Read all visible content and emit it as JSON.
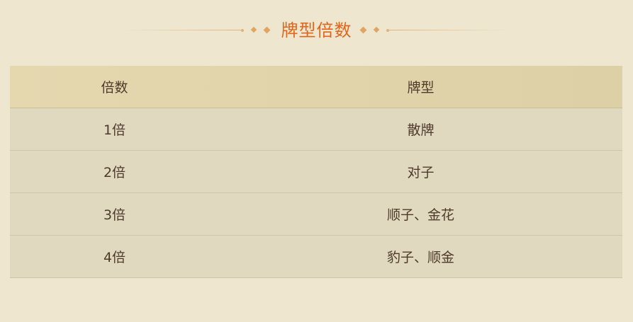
{
  "title": "牌型倍数",
  "table": {
    "headers": {
      "multiplier": "倍数",
      "hand": "牌型"
    },
    "rows": [
      {
        "multiplier": "1倍",
        "hand": "散牌"
      },
      {
        "multiplier": "2倍",
        "hand": "对子"
      },
      {
        "multiplier": "3倍",
        "hand": "顺子、金花"
      },
      {
        "multiplier": "4倍",
        "hand": "豹子、顺金"
      }
    ]
  },
  "colors": {
    "background": "#eee6ce",
    "title": "#e0661c",
    "header_bg": "#e0d1a8",
    "row_bg": "#e0d9c0",
    "text": "#4e3a2a",
    "accent": "#e0a562"
  }
}
